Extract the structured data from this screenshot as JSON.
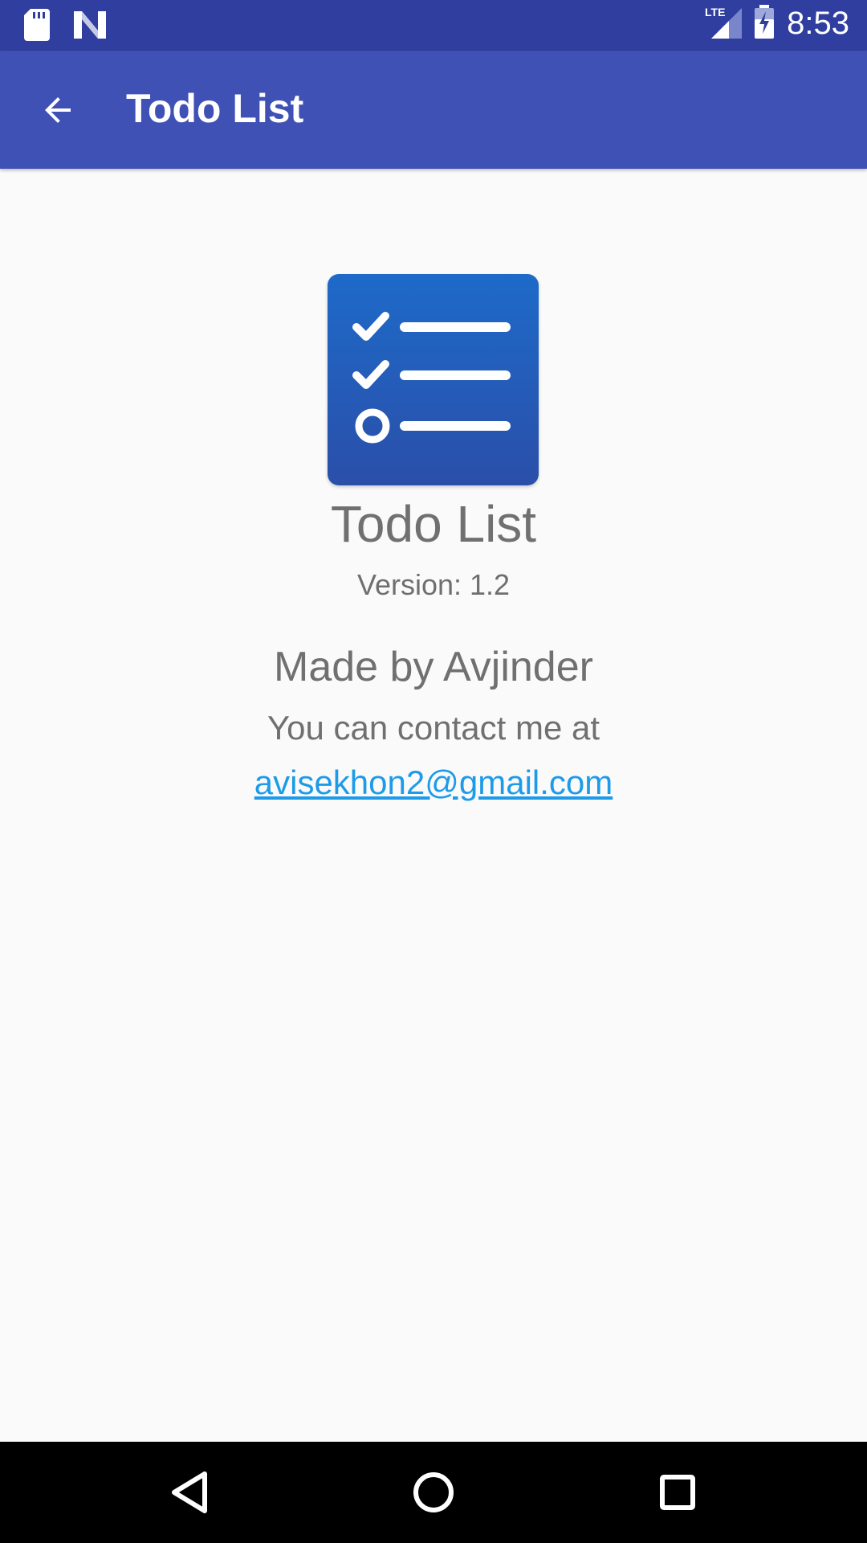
{
  "status_bar": {
    "time": "8:53",
    "network": "LTE",
    "icons": [
      "sd-card-icon",
      "n-logo-icon",
      "lte-signal-icon",
      "battery-charging-icon"
    ]
  },
  "app_bar": {
    "title": "Todo List",
    "back_icon": "arrow-back-icon"
  },
  "about": {
    "app_icon": "todo-list-app-icon",
    "app_name": "Todo List",
    "version": "Version: 1.2",
    "made_by": "Made by Avjinder",
    "contact_text": "You can contact me at",
    "email": "avisekhon2@gmail.com"
  },
  "nav_bar": {
    "icons": [
      "back-triangle-icon",
      "home-circle-icon",
      "recents-square-icon"
    ]
  },
  "colors": {
    "status_bar": "#303f9f",
    "app_bar": "#3f51b5",
    "link": "#1e9be8",
    "text": "#707070"
  }
}
